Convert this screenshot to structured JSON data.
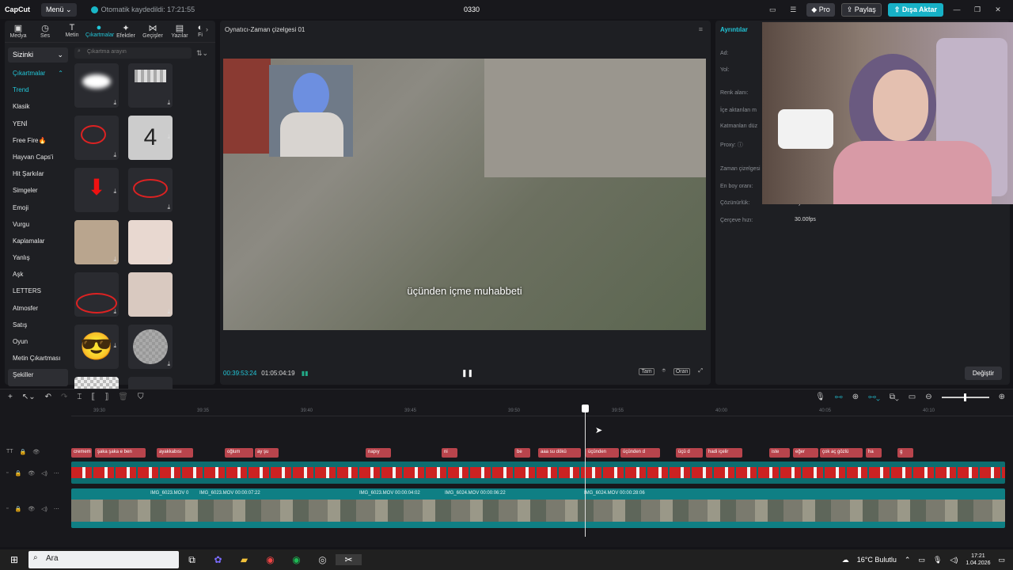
{
  "app": {
    "logo": "CapCut",
    "menu": "Menü",
    "autosave": "Otomatik kaydedildi: 17:21:55",
    "project": "0330"
  },
  "titlebar": {
    "pro": "Pro",
    "share": "Paylaş",
    "export": "Dışa Aktar"
  },
  "tabs": [
    {
      "label": "Medya",
      "icon": "media-icon"
    },
    {
      "label": "Ses",
      "icon": "audio-icon"
    },
    {
      "label": "Metin",
      "icon": "text-icon"
    },
    {
      "label": "Çıkartmalar",
      "icon": "sticker-icon",
      "active": true
    },
    {
      "label": "Efektler",
      "icon": "effects-icon"
    },
    {
      "label": "Geçişler",
      "icon": "transition-icon"
    },
    {
      "label": "Yazılar",
      "icon": "captions-icon"
    },
    {
      "label": "Fi",
      "icon": "filters-icon"
    }
  ],
  "sidebar": {
    "dropdown": "Sizinki",
    "section": "Çıkartmalar",
    "items": [
      "Trend",
      "Klasik",
      "YENİ",
      "Free Fire🔥",
      "Hayvan Caps'i",
      "Hit Şarkılar",
      "Simgeler",
      "Emoji",
      "Vurgu",
      "Kaplamalar",
      "Yanlış",
      "Aşk",
      "LETTERS",
      "Atmosfer",
      "Satış",
      "Oyun",
      "Metin Çıkartması",
      "Şekiller"
    ]
  },
  "search": {
    "placeholder": "Çıkartma arayın"
  },
  "player": {
    "title": "Oynatıcı-Zaman çizelgesi 01",
    "subtitle": "üçünden içme muhabbeti",
    "current_time": "00:39:53:24",
    "total_time": "01:05:04:19",
    "buttons": [
      "Tam",
      "Oran"
    ]
  },
  "details": {
    "title": "Ayrıntılar",
    "rows": [
      {
        "label": "Ad:",
        "value": ""
      },
      {
        "label": "Yol:",
        "value": ""
      },
      {
        "label": "Renk alanı:",
        "value": ""
      },
      {
        "label": "İçe aktarılan m",
        "value": ""
      },
      {
        "label": "Katmanları düz",
        "value": ""
      },
      {
        "label": "Proxy: ⓘ",
        "value": ""
      },
      {
        "label": "Zaman çizelgesi",
        "value": ""
      },
      {
        "label": "En boy oranı:",
        "value": ""
      },
      {
        "label": "Çözünürlük:",
        "value": "Uyarlanır"
      },
      {
        "label": "Çerçeve hızı:",
        "value": "30.00fps"
      }
    ],
    "change_button": "Değiştir"
  },
  "timeline": {
    "ticks": [
      "39:30",
      "39:35",
      "39:40",
      "39:45",
      "39:50",
      "39:55",
      "40:00",
      "40:05",
      "40:10"
    ],
    "text_clips": [
      "cremem",
      "şaka şaka e ben",
      "ayakkabısı",
      "oğlum",
      "ay şu",
      "napıy",
      "ni",
      "be",
      "aaa su dökü",
      "üçünden",
      "üçünden d",
      "üçü d",
      "hadi içelir",
      "iste",
      "eğer",
      "çok aç gözlü",
      "ha",
      "g"
    ],
    "video_clips": [
      {
        "label": "IMG_6023.MOV  0"
      },
      {
        "label": "IMG_6023.MOV  00:00:07:22"
      },
      {
        "label": "IMG_6023.MOV  00:00:04:02"
      },
      {
        "label": "IMG_6024.MOV  00:00:06:22"
      },
      {
        "label": "IMG_6024.MOV  00:00:28:06"
      }
    ]
  },
  "taskbar": {
    "search": "Ara",
    "weather": "16°C  Bulutlu",
    "time": "17:21",
    "date": "1.04.2026"
  }
}
